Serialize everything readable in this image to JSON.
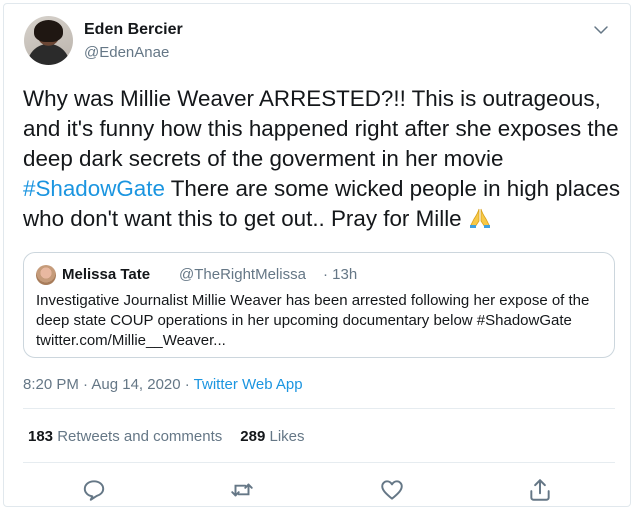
{
  "author": {
    "name": "Eden Bercier",
    "handle": "@EdenAnae"
  },
  "tweet": {
    "text_before": "Why was Millie Weaver ARRESTED?!! This is outrageous, and it's funny how this happened right after she exposes the deep dark secrets of the goverment in her movie ",
    "hashtag": "#ShadowGate",
    "text_after": " There are some wicked people in high places who don't want this to get out.. Pray for Mille ",
    "emoji": "folded-hands-emoji"
  },
  "quoted": {
    "name": "Melissa Tate",
    "handle": "@TheRightMelissa",
    "time": "· 13h",
    "text": "Investigative Journalist Millie Weaver has been arrested following her expose of the deep state COUP operations in her upcoming documentary below #ShadowGate twitter.com/Millie__Weaver..."
  },
  "meta": {
    "time": "8:20 PM · Aug 14, 2020 · ",
    "source": "Twitter Web App"
  },
  "stats": {
    "retweets_count": "183",
    "retweets_label": " Retweets and comments",
    "likes_count": "289",
    "likes_label": " Likes"
  },
  "icons": {
    "reply": "reply-icon",
    "retweet": "retweet-icon",
    "like": "heart-icon",
    "share": "share-icon",
    "menu": "chevron-down-icon"
  },
  "colors": {
    "link": "#1b95e0",
    "muted": "#657786",
    "text": "#14171a",
    "border": "#ccd6dd"
  }
}
